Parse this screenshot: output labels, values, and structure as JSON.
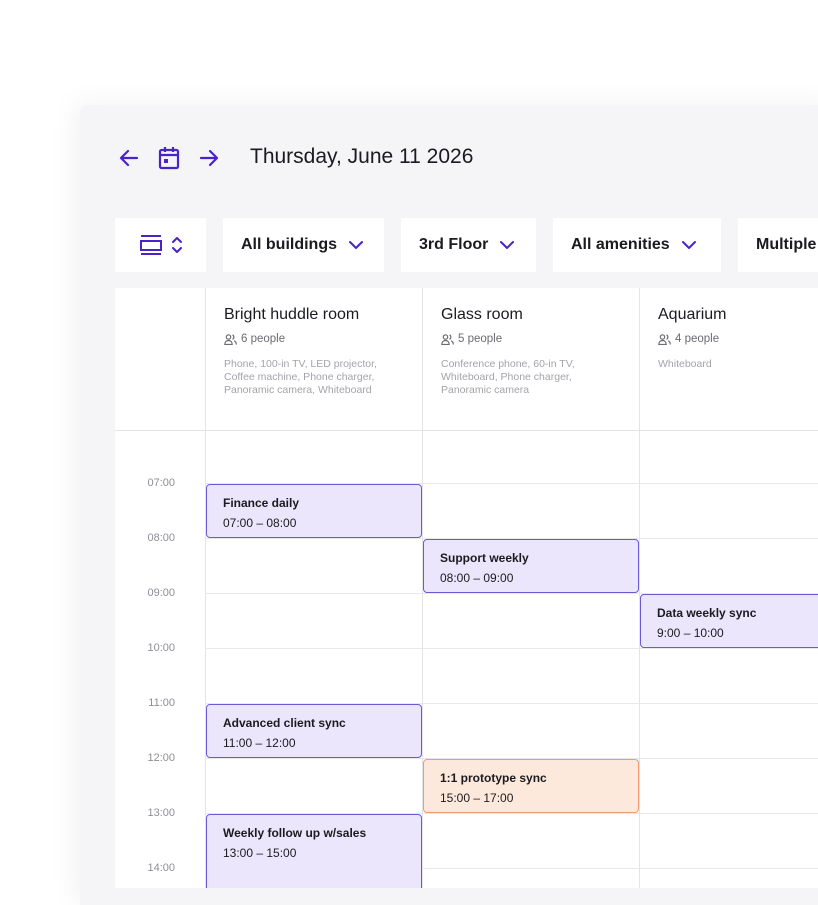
{
  "header": {
    "date_title": "Thursday, June 11 2026",
    "icons": [
      "arrow-left-icon",
      "calendar-icon",
      "arrow-right-icon"
    ],
    "accent_color": "#4a22c9"
  },
  "filters": [
    {
      "label": "All buildings"
    },
    {
      "label": "3rd Floor"
    },
    {
      "label": "All amenities"
    },
    {
      "label": "Multiple"
    }
  ],
  "rooms": [
    {
      "name": "Bright huddle room",
      "capacity": "6 people",
      "amenities": "Phone, 100-in TV, LED projector, Coffee machine, Phone charger, Panoramic camera, Whiteboard"
    },
    {
      "name": "Glass room",
      "capacity": "5 people",
      "amenities": "Conference phone, 60-in TV, Whiteboard, Phone charger, Panoramic camera"
    },
    {
      "name": "Aquarium",
      "capacity": "4 people",
      "amenities": "Whiteboard"
    }
  ],
  "times": [
    "07:00",
    "08:00",
    "09:00",
    "10:00",
    "11:00",
    "12:00",
    "13:00",
    "14:00"
  ],
  "events": [
    {
      "title": "Finance daily",
      "time": "07:00 – 08:00",
      "room": 0,
      "color": "purple"
    },
    {
      "title": "Support weekly",
      "time": "08:00 – 09:00",
      "room": 1,
      "color": "purple"
    },
    {
      "title": "Data weekly sync",
      "time": "9:00 – 10:00",
      "room": 2,
      "color": "purple"
    },
    {
      "title": "Advanced client sync",
      "time": "11:00 – 12:00",
      "room": 0,
      "color": "purple"
    },
    {
      "title": "1:1 prototype sync",
      "time": "15:00 – 17:00",
      "room": 1,
      "color": "orange"
    },
    {
      "title": "Weekly follow up w/sales",
      "time": "13:00 – 15:00",
      "room": 0,
      "color": "purple"
    }
  ]
}
